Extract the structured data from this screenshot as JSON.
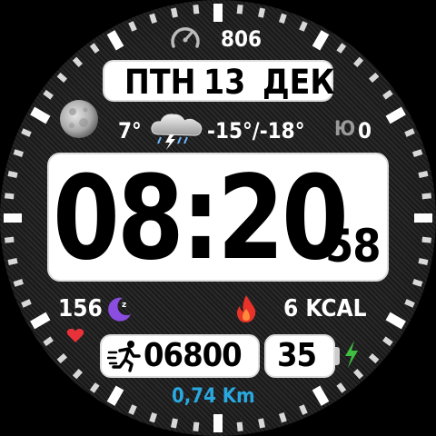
{
  "steps_counter_top": "806",
  "date": {
    "day_name": "ПТН",
    "day": "13",
    "month": "ДЕК"
  },
  "weather": {
    "current_temp": "7°",
    "range": "-15°/-18°",
    "wind_dir": "Ю",
    "wind_value": "0",
    "icon": "cloud-storm-icon"
  },
  "moon_icon": "moon-icon",
  "time": {
    "hours_minutes": "08:20",
    "seconds": "58"
  },
  "heart_rate": {
    "value": "156",
    "icon": "heart-icon"
  },
  "sleep_icon": "moon-sleep-icon",
  "calories": {
    "value": "6 KCAL",
    "icon": "flame-icon"
  },
  "steps": {
    "value": "06800",
    "icon": "runner-icon"
  },
  "battery": {
    "value": "35",
    "icon": "battery-charging-icon"
  },
  "distance": "0,74 Km",
  "colors": {
    "accent_blue": "#29a8e0",
    "sleep_purple": "#8a4de0",
    "flame_red": "#e8322a",
    "heart_red": "#e8323a",
    "bolt_green": "#3fbf3f"
  }
}
